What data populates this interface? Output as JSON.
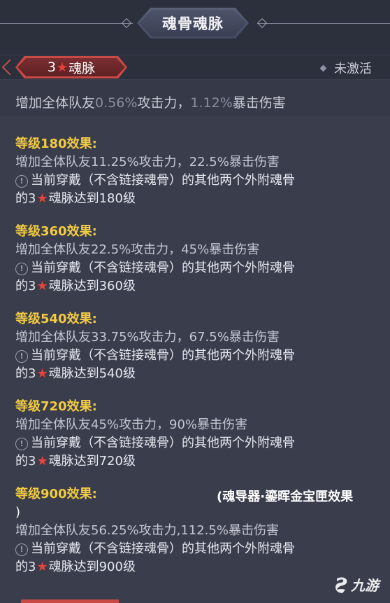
{
  "header": {
    "title": "魂骨魂脉"
  },
  "tag": {
    "stars": "3",
    "label": "魂脉"
  },
  "status": {
    "text": "未激活"
  },
  "summary": {
    "prefix": "增加全体队友",
    "atk": "0.56%",
    "mid": "攻击力，",
    "crit": "1.12%",
    "suffix": "暴击伤害"
  },
  "levels": [
    {
      "title": "等级180效果:",
      "line1": "增加全体队友11.25%攻击力，22.5%暴击伤害",
      "line2": "当前穿戴（不含链接魂骨）的其他两个外附魂骨",
      "line3_prefix": "的3",
      "line3_suffix": "魂脉达到180级"
    },
    {
      "title": "等级360效果:",
      "line1": "增加全体队友22.5%攻击力，45%暴击伤害",
      "line2": "当前穿戴（不含链接魂骨）的其他两个外附魂骨",
      "line3_prefix": "的3",
      "line3_suffix": "魂脉达到360级"
    },
    {
      "title": "等级540效果:",
      "line1": "增加全体队友33.75%攻击力，67.5%暴击伤害",
      "line2": "当前穿戴（不含链接魂骨）的其他两个外附魂骨",
      "line3_prefix": "的3",
      "line3_suffix": "魂脉达到540级"
    },
    {
      "title": "等级720效果:",
      "line1": "增加全体队友45%攻击力，90%暴击伤害",
      "line2": "当前穿戴（不含链接魂骨）的其他两个外附魂骨",
      "line3_prefix": "的3",
      "line3_suffix": "魂脉达到720级"
    },
    {
      "title": "等级900效果:",
      "extra": "(魂导器·鎏晖金宝匣效果",
      "extra_close": ")",
      "line1": "增加全体队友56.25%攻击力,112.5%暴击伤害",
      "line2": "当前穿戴（不含链接魂骨）的其他两个外附魂骨",
      "line3_prefix": "的3",
      "line3_suffix": "魂脉达到900级"
    }
  ],
  "watermark": {
    "text": "九游"
  },
  "icons": {
    "star": "★",
    "warning": "!"
  },
  "colors": {
    "gold": "#f2cb42",
    "red_tag": "#c94a45",
    "star": "#e8433c"
  }
}
